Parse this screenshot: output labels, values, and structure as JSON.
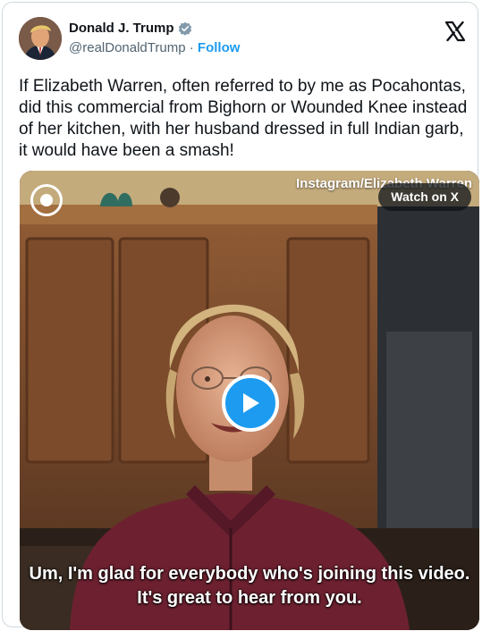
{
  "tweet": {
    "author_name": "Donald J. Trump",
    "handle": "@realDonaldTrump",
    "separator": " · ",
    "follow_label": "Follow",
    "verified_icon": "verified-badge-icon",
    "platform_icon": "x-logo-icon",
    "text": "If Elizabeth Warren, often referred to by me as Pocahontas, did this commercial from Bighorn or Wounded Knee instead of her kitchen, with her husband dressed in full Indian garb, it would have been a smash!"
  },
  "video": {
    "source_credit": "Instagram/Elizabeth Warren",
    "watch_label": "Watch on X",
    "broadcaster_icon": "cbs-eye-logo-icon",
    "caption_lines": [
      "Um, I'm glad for everybody who's joining this video.",
      "It's great to hear from you."
    ]
  },
  "colors": {
    "accent": "#1d9bf0",
    "text_primary": "#0f1419",
    "text_secondary": "#536471",
    "border": "#cfd9de"
  }
}
